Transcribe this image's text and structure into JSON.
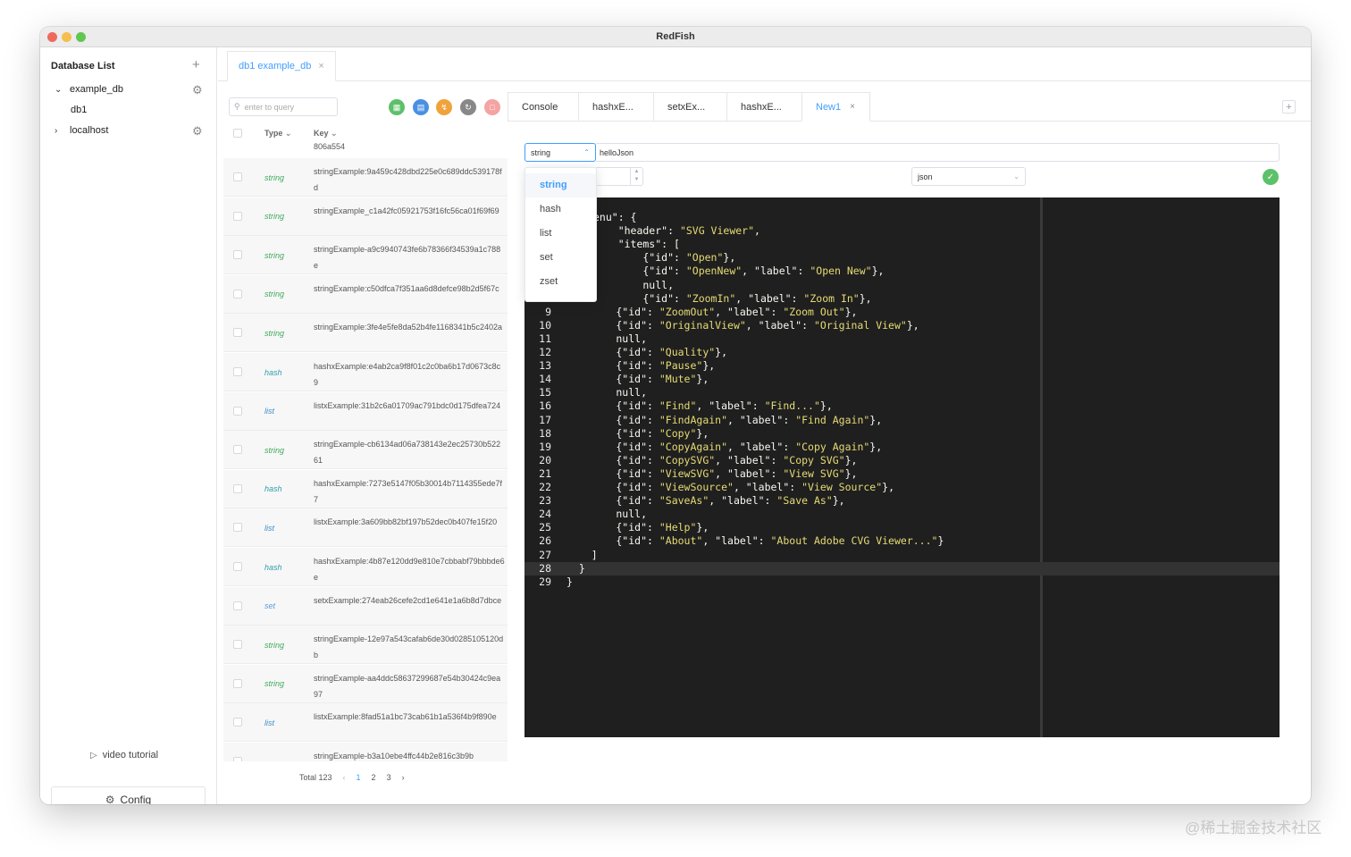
{
  "window": {
    "title": "RedFish"
  },
  "sidebar": {
    "title": "Database List",
    "add_icon": "plus-icon",
    "items": [
      {
        "label": "example_db",
        "expanded": true
      },
      {
        "label": "db1"
      },
      {
        "label": "localhost",
        "expanded": false
      }
    ],
    "video_tutorial": "video tutorial",
    "config": "Config"
  },
  "db_tab": {
    "label": "db1 example_db"
  },
  "search": {
    "placeholder": "enter to query"
  },
  "toolbar": {
    "buttons": [
      {
        "name": "add",
        "color": "#5cc16a"
      },
      {
        "name": "save",
        "color": "#4a90e2"
      },
      {
        "name": "flash",
        "color": "#f0a33b"
      },
      {
        "name": "refresh",
        "color": "#888888"
      },
      {
        "name": "delete",
        "color": "#f5a3a3"
      }
    ]
  },
  "list": {
    "header": {
      "type": "Type",
      "key": "Key"
    },
    "partial_top": "806a554",
    "rows": [
      {
        "type": "string",
        "key": "stringExample:9a459c428dbd225e0c689ddc539178fd"
      },
      {
        "type": "string",
        "key": "stringExample_c1a42fc05921753f16fc56ca01f69f69"
      },
      {
        "type": "string",
        "key": "stringExample-a9c9940743fe6b78366f34539a1c788e"
      },
      {
        "type": "string",
        "key": "stringExample:c50dfca7f351aa6d8defce98b2d5f67c"
      },
      {
        "type": "string",
        "key": "stringExample:3fe4e5fe8da52b4fe1168341b5c2402a"
      },
      {
        "type": "hash",
        "key": "hashxExample:e4ab2ca9f8f01c2c0ba6b17d0673c8c9"
      },
      {
        "type": "list",
        "key": "listxExample:31b2c6a01709ac791bdc0d175dfea724"
      },
      {
        "type": "string",
        "key": "stringExample-cb6134ad06a738143e2ec25730b52261"
      },
      {
        "type": "hash",
        "key": "hashxExample:7273e5147f05b30014b7114355ede7f7"
      },
      {
        "type": "list",
        "key": "listxExample:3a609bb82bf197b52dec0b407fe15f20"
      },
      {
        "type": "hash",
        "key": "hashxExample:4b87e120dd9e810e7cbbabf79bbbde6e"
      },
      {
        "type": "set",
        "key": "setxExample:274eab26cefe2cd1e641e1a6b8d7dbce"
      },
      {
        "type": "string",
        "key": "stringExample-12e97a543cafab6de30d0285105120db"
      },
      {
        "type": "string",
        "key": "stringExample-aa4ddc58637299687e54b30424c9ea97"
      },
      {
        "type": "list",
        "key": "listxExample:8fad51a1bc73cab61b1a536f4b9f890e"
      },
      {
        "type": "",
        "key": "stringExample-b3a10ebe4ffc44b2e816c3b9b"
      }
    ]
  },
  "pager": {
    "total": "Total 123",
    "pages": [
      "1",
      "2",
      "3"
    ],
    "current": "1"
  },
  "tabs": [
    {
      "label": "Console"
    },
    {
      "label": "hashxE..."
    },
    {
      "label": "setxEx..."
    },
    {
      "label": "hashxE..."
    },
    {
      "label": "New1",
      "active": true
    }
  ],
  "editor": {
    "key_type": "string",
    "key_name": "helloJson",
    "format": "json",
    "type_options": [
      "string",
      "hash",
      "list",
      "set",
      "zset"
    ],
    "lines": [
      {
        "n": "",
        "text": "enu\": {"
      },
      {
        "n": "",
        "text": "    \"header\": \"SVG Viewer\","
      },
      {
        "n": "",
        "text": "    \"items\": ["
      },
      {
        "n": "",
        "text": "        {\"id\": \"Open\"},"
      },
      {
        "n": "",
        "text": "        {\"id\": \"OpenNew\", \"label\": \"Open New\"},"
      },
      {
        "n": "",
        "text": "        null,"
      },
      {
        "n": "",
        "text": "        {\"id\": \"ZoomIn\", \"label\": \"Zoom In\"},"
      },
      {
        "n": "9",
        "text": "        {\"id\": \"ZoomOut\", \"label\": \"Zoom Out\"},"
      },
      {
        "n": "10",
        "text": "        {\"id\": \"OriginalView\", \"label\": \"Original View\"},"
      },
      {
        "n": "11",
        "text": "        null,"
      },
      {
        "n": "12",
        "text": "        {\"id\": \"Quality\"},"
      },
      {
        "n": "13",
        "text": "        {\"id\": \"Pause\"},"
      },
      {
        "n": "14",
        "text": "        {\"id\": \"Mute\"},"
      },
      {
        "n": "15",
        "text": "        null,"
      },
      {
        "n": "16",
        "text": "        {\"id\": \"Find\", \"label\": \"Find...\"},"
      },
      {
        "n": "17",
        "text": "        {\"id\": \"FindAgain\", \"label\": \"Find Again\"},"
      },
      {
        "n": "18",
        "text": "        {\"id\": \"Copy\"},"
      },
      {
        "n": "19",
        "text": "        {\"id\": \"CopyAgain\", \"label\": \"Copy Again\"},"
      },
      {
        "n": "20",
        "text": "        {\"id\": \"CopySVG\", \"label\": \"Copy SVG\"},"
      },
      {
        "n": "21",
        "text": "        {\"id\": \"ViewSVG\", \"label\": \"View SVG\"},"
      },
      {
        "n": "22",
        "text": "        {\"id\": \"ViewSource\", \"label\": \"View Source\"},"
      },
      {
        "n": "23",
        "text": "        {\"id\": \"SaveAs\", \"label\": \"Save As\"},"
      },
      {
        "n": "24",
        "text": "        null,"
      },
      {
        "n": "25",
        "text": "        {\"id\": \"Help\"},"
      },
      {
        "n": "26",
        "text": "        {\"id\": \"About\", \"label\": \"About Adobe CVG Viewer...\"}"
      },
      {
        "n": "27",
        "text": "    ]"
      },
      {
        "n": "28",
        "text": "  }"
      },
      {
        "n": "29",
        "text": "}"
      }
    ]
  },
  "watermark": "@稀土掘金技术社区"
}
